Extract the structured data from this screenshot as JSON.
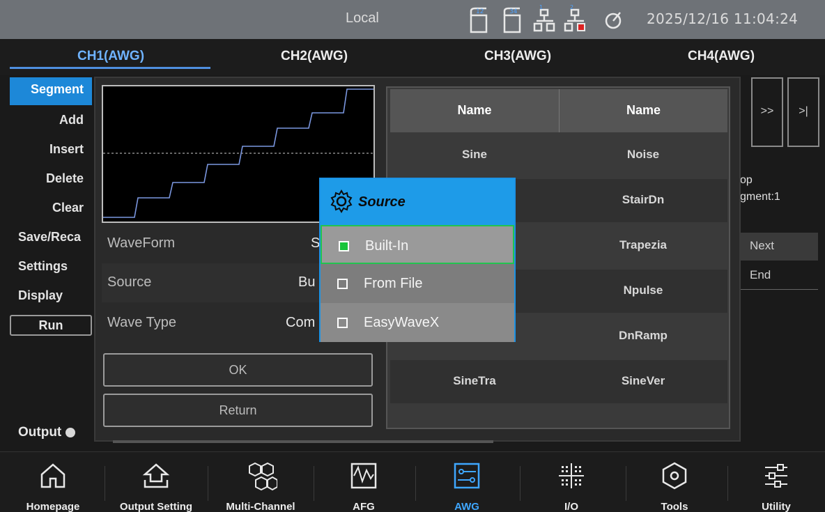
{
  "status": {
    "mode": "Local",
    "datetime": "2025/12/16 11:04:24",
    "icons": [
      "ch12-icon",
      "ch34-icon",
      "network-icon",
      "network-disconnected-icon",
      "sync-icon"
    ]
  },
  "tabs": [
    {
      "label": "CH1(AWG)",
      "active": true
    },
    {
      "label": "CH2(AWG)",
      "active": false
    },
    {
      "label": "CH3(AWG)",
      "active": false
    },
    {
      "label": "CH4(AWG)",
      "active": false
    }
  ],
  "menu": {
    "items": [
      "Segment",
      "Add",
      "Insert",
      "Delete",
      "Clear",
      "Save/Reca",
      "Settings",
      "Display"
    ],
    "selected": "Segment",
    "run": "Run",
    "output": "Output"
  },
  "right_panel": {
    "nav_next": ">>",
    "nav_end": ">|",
    "text1": "op",
    "text2": "gment:1",
    "row1": "Next",
    "row2": "End"
  },
  "dialog": {
    "rows": [
      {
        "label": "WaveForm",
        "value": "S"
      },
      {
        "label": "Source",
        "value": "Bu"
      },
      {
        "label": "Wave Type",
        "value": "Com"
      }
    ],
    "ok": "OK",
    "return": "Return"
  },
  "wavelist": {
    "headers": [
      "Name",
      "Name"
    ],
    "rows": [
      [
        "Sine",
        "Noise"
      ],
      [
        "",
        "StairDn"
      ],
      [
        "",
        "Trapezia"
      ],
      [
        "",
        "Npulse"
      ],
      [
        "",
        "DnRamp"
      ],
      [
        "SineTra",
        "SineVer"
      ]
    ]
  },
  "popup": {
    "title": "Source",
    "options": [
      {
        "label": "Built-In",
        "checked": true,
        "selected": true
      },
      {
        "label": "From File",
        "checked": false,
        "selected": false
      },
      {
        "label": "EasyWaveX",
        "checked": false,
        "selected": false
      }
    ]
  },
  "dock": [
    {
      "label": "Homepage",
      "icon": "home-icon",
      "active": false
    },
    {
      "label": "Output Setting",
      "icon": "output-icon",
      "active": false
    },
    {
      "label": "Multi-Channel",
      "icon": "multichannel-icon",
      "active": false
    },
    {
      "label": "AFG",
      "icon": "afg-icon",
      "active": false
    },
    {
      "label": "AWG",
      "icon": "awg-icon",
      "active": true
    },
    {
      "label": "I/O",
      "icon": "io-icon",
      "active": false
    },
    {
      "label": "Tools",
      "icon": "tools-icon",
      "active": false
    },
    {
      "label": "Utility",
      "icon": "utility-icon",
      "active": false
    }
  ],
  "colors": {
    "accent": "#1d88d8",
    "tab_active": "#6fb3ff",
    "popup_title": "#1e9be8",
    "check_on": "#18c43a",
    "waveform_trace": "#6f8fd8"
  }
}
